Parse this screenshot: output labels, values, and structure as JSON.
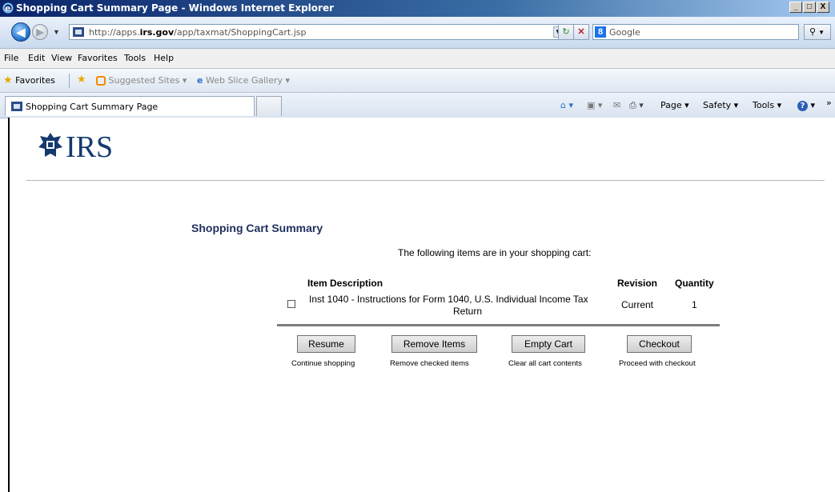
{
  "window": {
    "title": "Shopping Cart Summary Page - Windows Internet Explorer",
    "minimize": "_",
    "maximize": "□",
    "close": "X"
  },
  "address_bar": {
    "url_prefix": "http://apps.",
    "url_domain": "irs.gov",
    "url_path": "/app/taxmat/ShoppingCart.jsp",
    "search_placeholder": "Google"
  },
  "menu": [
    "File",
    "Edit",
    "View",
    "Favorites",
    "Tools",
    "Help"
  ],
  "favorites_bar": {
    "favorites_label": "Favorites",
    "suggested_sites": "Suggested Sites ▾",
    "web_slice_gallery": "Web Slice Gallery ▾"
  },
  "tab": {
    "label": "Shopping Cart Summary Page"
  },
  "command_bar": {
    "page": "Page ▾",
    "safety": "Safety ▾",
    "tools": "Tools ▾"
  },
  "page": {
    "logo_text": "IRS",
    "section_title": "Shopping Cart Summary",
    "intro": "The following items are in your shopping cart:",
    "table": {
      "headers": {
        "description": "Item Description",
        "revision": "Revision",
        "quantity": "Quantity"
      },
      "rows": [
        {
          "description_line1": "Inst 1040 - Instructions for Form 1040, U.S. Individual Income Tax",
          "description_line2": "Return",
          "revision": "Current",
          "quantity": "1",
          "checked": false
        }
      ]
    },
    "buttons": [
      {
        "label": "Resume",
        "caption": "Continue shopping"
      },
      {
        "label": "Remove Items",
        "caption": "Remove checked items"
      },
      {
        "label": "Empty Cart",
        "caption": "Clear all cart contents"
      },
      {
        "label": "Checkout",
        "caption": "Proceed with checkout"
      }
    ]
  },
  "colors": {
    "titlebar": "#0a246a",
    "section_title": "#1f2f5c",
    "irs_logo": "#143a6e"
  }
}
